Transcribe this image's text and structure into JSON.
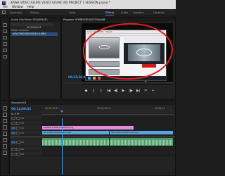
{
  "titlebar": {
    "logo": "Pr",
    "title": "...KAWA VIDEO AZURE VIDEO AZURE VID PROJECT 1 SESSION.prproj *"
  },
  "menubar": {
    "items": [
      "File",
      "Window",
      "Help"
    ]
  },
  "workspaces": {
    "tabs": [
      "Assembly",
      "Editing",
      "Color",
      "Effects",
      "Audio",
      "Graphics",
      "Libraries"
    ],
    "active": "Effects"
  },
  "source": {
    "header": "Audio Clip Mixer: SEQUENCE1",
    "timecode": "00;24;24;01",
    "label": "Media Browser",
    "item": "NGG7MCD0000FM10.0.MP4"
  },
  "program": {
    "header": "Program: ISYDROGEO00TOSAAKB",
    "inner_title": "Azure Video Editor - Project",
    "timecode": "00;22;26;01",
    "fit": "Fit",
    "transport": [
      "◆",
      "{",
      "}",
      "|◀",
      "◀|",
      "▶",
      "|▶",
      "▶|",
      "✂",
      "+"
    ]
  },
  "timeline": {
    "header": "Sequence01",
    "timecode": "00;24;00;01",
    "ruler": [
      "00;20;16;13",
      "00;24;20;01",
      "00;28;24"
    ],
    "tracks": [
      {
        "name": "V4"
      },
      {
        "name": "V3"
      },
      {
        "name": "V2"
      },
      {
        "name": "V1",
        "clip": "LOWER THIRD OVERLAY.png",
        "clip_color": "pink"
      },
      {
        "name": "A1",
        "clip": "NGG7MCD0000FM10.mp4",
        "clip2": "NGG7MCD0000FM10.mp4",
        "clip_color": "blue"
      },
      {
        "name": "A2"
      },
      {
        "name": "A3"
      }
    ]
  },
  "annotation": {
    "color": "#e21f1f"
  },
  "colors": {
    "accent": "#3aa0ff",
    "pink_clip": "#e38ad9",
    "blue_clip": "#5aa6d8"
  }
}
